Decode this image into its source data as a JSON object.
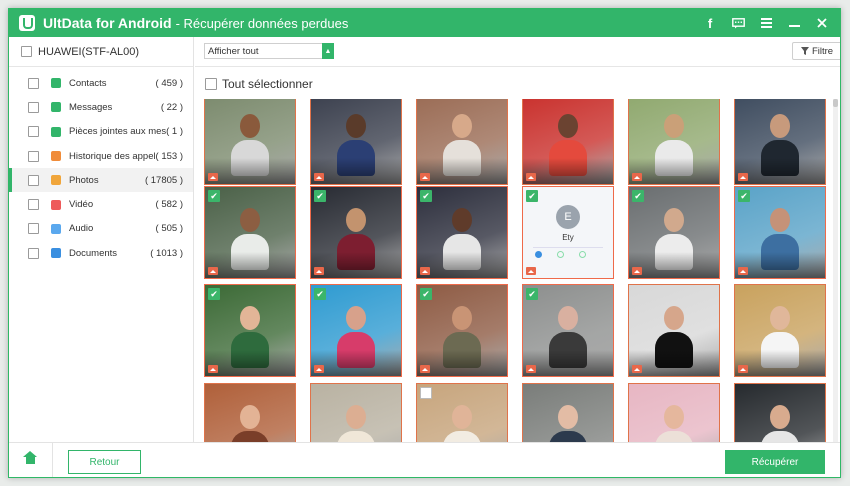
{
  "app": {
    "title": "UltData for Android",
    "subtitle": "- Récupérer données perdues",
    "titlebar_icons": [
      "facebook-icon",
      "feedback-icon",
      "menu-icon",
      "minimize-icon",
      "close-icon"
    ]
  },
  "sidebar": {
    "device": "HUAWEI(STF-AL00)",
    "items": [
      {
        "label": "Contacts",
        "count": "( 459 )",
        "icon": "contacts-icon",
        "color": "#32b56a"
      },
      {
        "label": "Messages",
        "count": "( 22 )",
        "icon": "messages-icon",
        "color": "#32b56a"
      },
      {
        "label": "Pièces jointes aux mes...",
        "count": "( 1 )",
        "icon": "attachments-icon",
        "color": "#32b56a"
      },
      {
        "label": "Historique des appels",
        "count": "( 153 )",
        "icon": "call-history-icon",
        "color": "#f08c3a"
      },
      {
        "label": "Photos",
        "count": "( 17805 )",
        "icon": "photos-icon",
        "color": "#f0a53a"
      },
      {
        "label": "Vidéo",
        "count": "( 582 )",
        "icon": "video-icon",
        "color": "#ee5a5a"
      },
      {
        "label": "Audio",
        "count": "( 505 )",
        "icon": "audio-icon",
        "color": "#5aa8ee"
      },
      {
        "label": "Documents",
        "count": "( 1013 )",
        "icon": "documents-icon",
        "color": "#3a8fe0"
      }
    ],
    "active_index": 4
  },
  "toolbar": {
    "filter_select": "Afficher tout",
    "filter_button": "Filtre",
    "select_all": "Tout sélectionner"
  },
  "photos": {
    "rows": [
      [
        {
          "checked": false,
          "bg": "#7b8a6d",
          "skin": "#8a5a3c",
          "cloth": "#d8d8d8"
        },
        {
          "checked": false,
          "bg": "#3a3f4d",
          "skin": "#5a3b2a",
          "cloth": "#2b3f74"
        },
        {
          "checked": false,
          "bg": "#9a6b54",
          "skin": "#d7a98a",
          "cloth": "#e5e0da"
        },
        {
          "checked": false,
          "bg": "#c9302c",
          "skin": "#6b4331",
          "cloth": "#e44a3d"
        },
        {
          "checked": false,
          "bg": "#8fa86e",
          "skin": "#caa078",
          "cloth": "#eaeaea"
        },
        {
          "checked": false,
          "bg": "#3d4b5e",
          "skin": "#c79a7c",
          "cloth": "#1f2730"
        }
      ],
      [
        {
          "checked": true,
          "bg": "#4b6148",
          "skin": "#8c5e42",
          "cloth": "#e9ece9"
        },
        {
          "checked": true,
          "bg": "#282b33",
          "skin": "#c3936e",
          "cloth": "#7d1e30"
        },
        {
          "checked": true,
          "bg": "#2d2f3d",
          "skin": "#5f3b2a",
          "cloth": "#e6e6e6"
        },
        {
          "checked": true,
          "phone": true,
          "contact_initial": "E",
          "contact_name": "Ety"
        },
        {
          "checked": true,
          "bg": "#6a6e70",
          "skin": "#d1a98d",
          "cloth": "#ececec"
        },
        {
          "checked": true,
          "bg": "#5aa3c8",
          "skin": "#c59278",
          "cloth": "#3d6fa1"
        }
      ],
      [
        {
          "checked": true,
          "bg": "#3c6a36",
          "skin": "#e2b597",
          "cloth": "#2e6b3d"
        },
        {
          "checked": true,
          "bg": "#2f9bd1",
          "skin": "#d7a18b",
          "cloth": "#d73c6a"
        },
        {
          "checked": true,
          "bg": "#8e5b44",
          "skin": "#c99475",
          "cloth": "#6c6a52"
        },
        {
          "checked": true,
          "bg": "#8d8f8e",
          "skin": "#d9b0a0",
          "cloth": "#3a3a3a"
        },
        {
          "checked": false,
          "bg": "#d8d8d8",
          "skin": "#d6a68b",
          "cloth": "#111111"
        },
        {
          "checked": false,
          "bg": "#c9a25e",
          "skin": "#e0b79a",
          "cloth": "#f5f5f5"
        }
      ],
      [
        {
          "checked": false,
          "bg": "#b0603a",
          "skin": "#e3b395",
          "cloth": "#7a3e29"
        },
        {
          "checked": false,
          "bg": "#b9b2a2",
          "skin": "#dcae92",
          "cloth": "#f0e7d8"
        },
        {
          "checked": false,
          "bg": "#c7a57d",
          "skin": "#e0b498",
          "cloth": "#f2ece2"
        },
        {
          "checked": false,
          "bg": "#7a7d7a",
          "skin": "#e3bca5",
          "cloth": "#2c3a4d"
        },
        {
          "checked": false,
          "bg": "#e7b6c3",
          "skin": "#e5b79d",
          "cloth": "#ece0d8"
        },
        {
          "checked": false,
          "bg": "#262a2e",
          "skin": "#d8ab8e",
          "cloth": "#e6e6e6"
        }
      ]
    ]
  },
  "footer": {
    "back": "Retour",
    "recover": "Récupérer"
  },
  "colors": {
    "brand_green": "#32b56a",
    "selection_border": "#e0734a"
  }
}
